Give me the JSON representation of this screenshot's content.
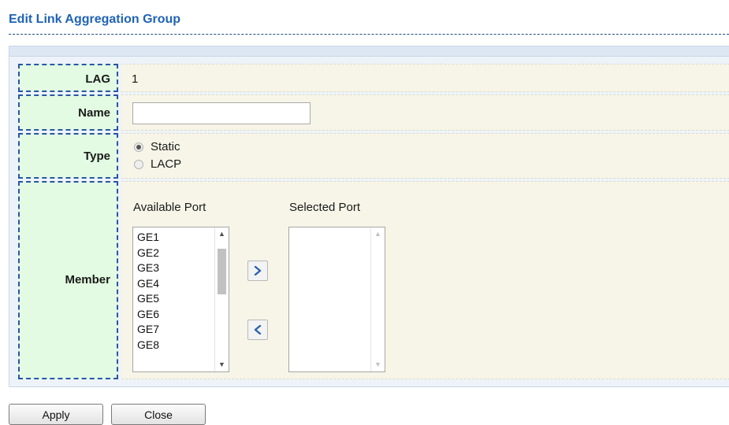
{
  "page": {
    "title": "Edit Link Aggregation Group"
  },
  "form": {
    "lag": {
      "label": "LAG",
      "value": "1"
    },
    "name": {
      "label": "Name",
      "value": "",
      "placeholder": ""
    },
    "type": {
      "label": "Type",
      "options": [
        {
          "label": "Static",
          "checked": true
        },
        {
          "label": "LACP",
          "checked": false
        }
      ]
    },
    "member": {
      "label": "Member",
      "available_label": "Available Port",
      "selected_label": "Selected Port",
      "available_ports": [
        "GE1",
        "GE2",
        "GE3",
        "GE4",
        "GE5",
        "GE6",
        "GE7",
        "GE8"
      ],
      "selected_ports": []
    }
  },
  "buttons": {
    "apply": "Apply",
    "close": "Close"
  },
  "icons": {
    "add": "chevron-right-icon",
    "remove": "chevron-left-icon",
    "scroll_up": "scroll-up-arrow-icon",
    "scroll_down": "scroll-down-arrow-icon"
  },
  "colors": {
    "title": "#1f63b4",
    "label_bg": "#e2fbe2",
    "value_bg": "#f7f5e8",
    "panel_bg": "#eef3f9",
    "dashed_border": "#2a55a6"
  }
}
